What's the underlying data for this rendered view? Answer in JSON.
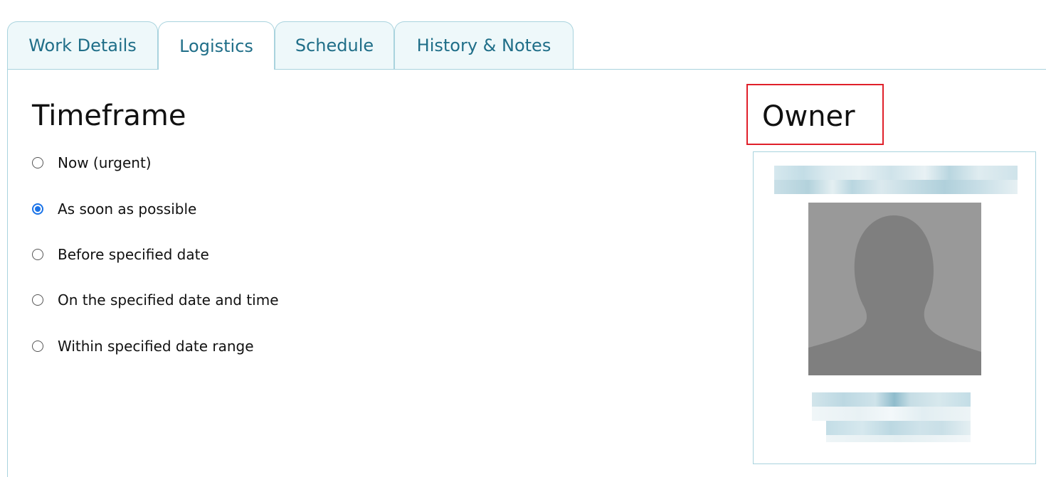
{
  "tabs": [
    {
      "label": "Work Details",
      "active": false
    },
    {
      "label": "Logistics",
      "active": true
    },
    {
      "label": "Schedule",
      "active": false
    },
    {
      "label": "History & Notes",
      "active": false
    }
  ],
  "timeframe": {
    "title": "Timeframe",
    "options": [
      {
        "label": "Now (urgent)",
        "checked": false
      },
      {
        "label": "As soon as possible",
        "checked": true
      },
      {
        "label": "Before specified date",
        "checked": false
      },
      {
        "label": "On the specified date and time",
        "checked": false
      },
      {
        "label": "Within specified date range",
        "checked": false
      }
    ]
  },
  "owner": {
    "title": "Owner",
    "avatar_icon": "person-silhouette-icon",
    "highlight_color": "#e0202a"
  },
  "colors": {
    "tab_text": "#1f6e88",
    "tab_border": "#a9d3de",
    "tab_bg": "#eef8fa",
    "radio_checked": "#1a73e8"
  }
}
